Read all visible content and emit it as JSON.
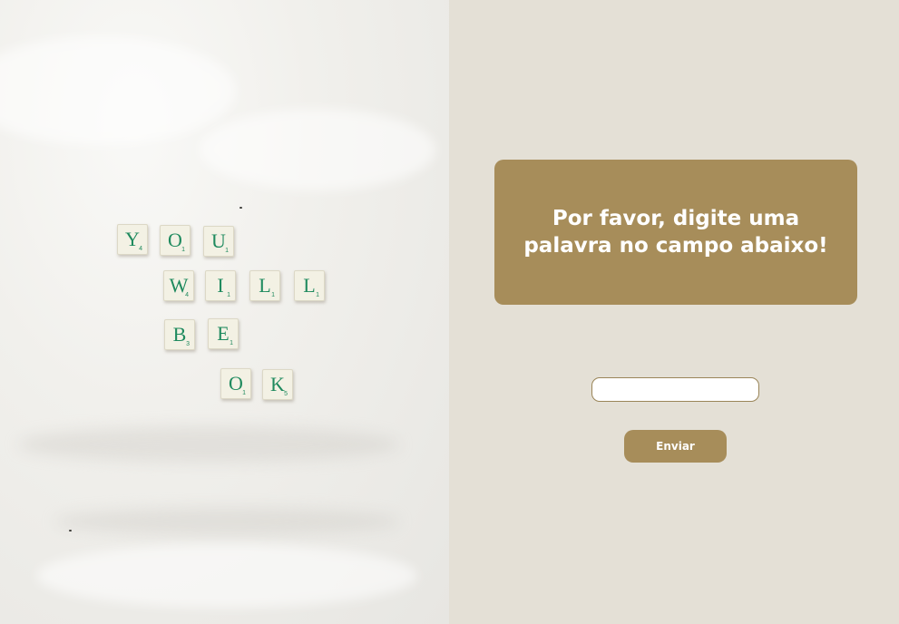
{
  "photo": {
    "tiles": [
      {
        "letter": "Y",
        "score": "4"
      },
      {
        "letter": "O",
        "score": "1"
      },
      {
        "letter": "U",
        "score": "1"
      },
      {
        "letter": "W",
        "score": "4"
      },
      {
        "letter": "I",
        "score": "1"
      },
      {
        "letter": "L",
        "score": "1"
      },
      {
        "letter": "L",
        "score": "1"
      },
      {
        "letter": "B",
        "score": "3"
      },
      {
        "letter": "E",
        "score": "1"
      },
      {
        "letter": "O",
        "score": "1"
      },
      {
        "letter": "K",
        "score": "5"
      }
    ]
  },
  "form": {
    "message": "Por favor, digite uma palavra no campo abaixo!",
    "input_value": "",
    "input_placeholder": "",
    "submit_label": "Enviar"
  },
  "colors": {
    "accent": "#a78d5a",
    "panel_background": "#e4e0d6",
    "tile_letter": "#1f8a5e"
  }
}
